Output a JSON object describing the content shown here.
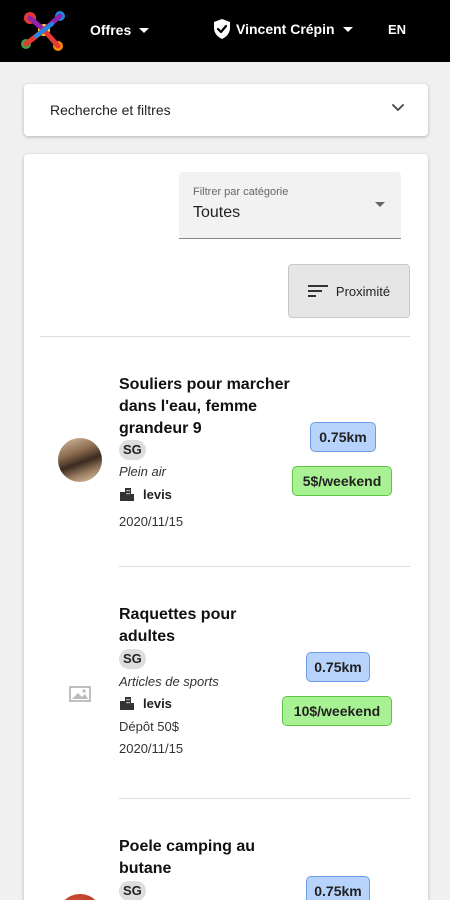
{
  "header": {
    "offers_label": "Offres",
    "user_name": "Vincent Crépin",
    "lang": "EN"
  },
  "search": {
    "label": "Recherche et filtres"
  },
  "filter": {
    "label": "Filtrer par catégorie",
    "value": "Toutes"
  },
  "sort": {
    "label": "Proximité"
  },
  "items": [
    {
      "title": "Souliers pour marcher dans l'eau, femme grandeur 9",
      "tag": "SG",
      "category": "Plein air",
      "location": "levis",
      "deposit": "",
      "date": "2020/11/15",
      "distance": "0.75km",
      "price": "5$/weekend"
    },
    {
      "title": "Raquettes pour adultes",
      "tag": "SG",
      "category": "Articles de sports",
      "location": "levis",
      "deposit": "Dépôt 50$",
      "date": "2020/11/15",
      "distance": "0.75km",
      "price": "10$/weekend"
    },
    {
      "title": "Poele camping au butane",
      "tag": "SG",
      "distance": "0.75km"
    }
  ]
}
